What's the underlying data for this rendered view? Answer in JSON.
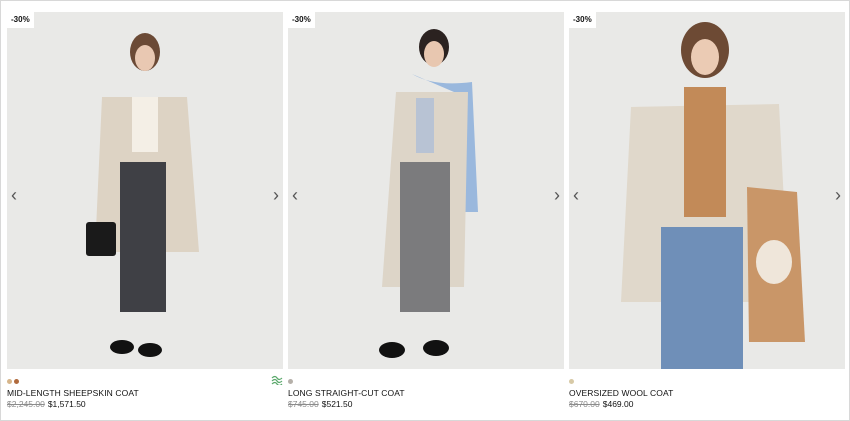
{
  "products": [
    {
      "badge": "-30%",
      "name": "MID-LENGTH SHEEPSKIN COAT",
      "old_price": "$2,245.00",
      "new_price": "$1,571.50",
      "swatch_colors": [
        "#d6b58a",
        "#b06a3d"
      ],
      "eco_icon": "eco-wave-icon",
      "prev_icon": "chevron-left-icon",
      "next_icon": "chevron-right-icon"
    },
    {
      "badge": "-30%",
      "name": "LONG STRAIGHT-CUT COAT",
      "old_price": "$745.00",
      "new_price": "$521.50",
      "swatch_colors": [
        "#b5b0a9"
      ],
      "prev_icon": "chevron-left-icon",
      "next_icon": "chevron-right-icon"
    },
    {
      "badge": "-30%",
      "name": "OVERSIZED WOOL COAT",
      "old_price": "$670.00",
      "new_price": "$469.00",
      "swatch_colors": [
        "#d7c9a6"
      ],
      "prev_icon": "chevron-left-icon",
      "next_icon": "chevron-right-icon"
    }
  ]
}
